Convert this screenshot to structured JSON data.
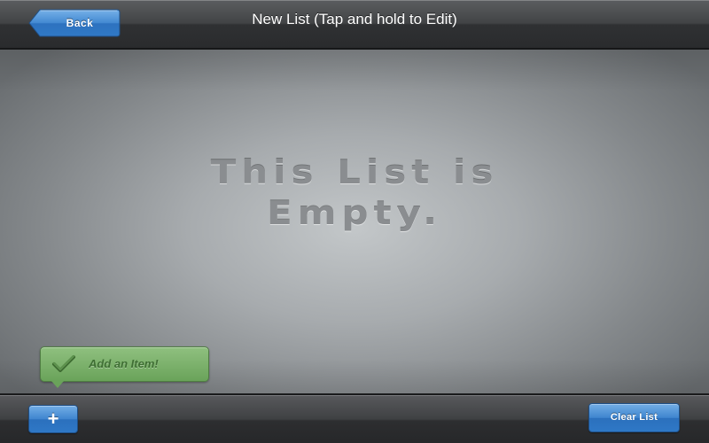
{
  "header": {
    "back_label": "Back",
    "title": "New List (Tap and hold to Edit)"
  },
  "main": {
    "empty_message": [
      "This List is",
      "Empty."
    ]
  },
  "tooltip": {
    "label": "Add an Item!",
    "icon": "checkmark-icon"
  },
  "footer": {
    "add_label": "+",
    "clear_label": "Clear List"
  },
  "colors": {
    "button_blue": "#3f85cf",
    "tooltip_green": "#7ab06a",
    "bar_dark": "#3a3c3e"
  }
}
